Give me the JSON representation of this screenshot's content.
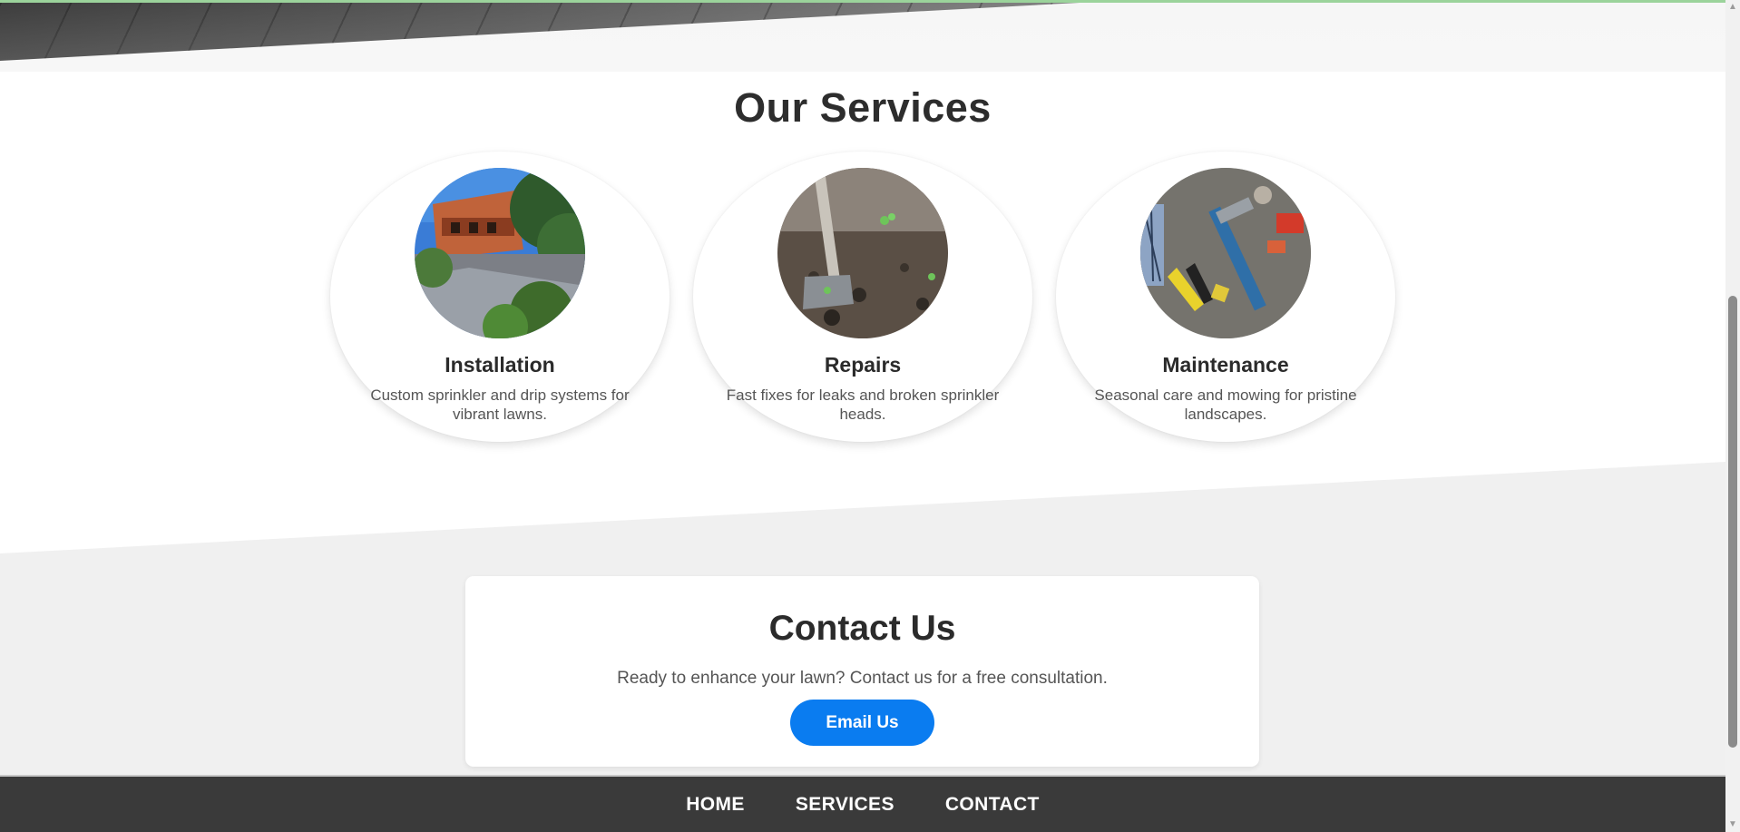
{
  "colors": {
    "accent": "#0a7cf0",
    "footer_bg": "#3a3a3a",
    "contact_bg": "#f0f0f0",
    "top_line": "#9bd39b"
  },
  "services": {
    "title": "Our Services",
    "items": [
      {
        "title": "Installation",
        "description": "Custom sprinkler and drip systems for vibrant lawns.",
        "image_icon": "building-garden-photo"
      },
      {
        "title": "Repairs",
        "description": "Fast fixes for leaks and broken sprinkler heads.",
        "image_icon": "garden-hoe-soil-photo"
      },
      {
        "title": "Maintenance",
        "description": "Seasonal care and mowing for pristine landscapes.",
        "image_icon": "tools-photo"
      }
    ]
  },
  "contact": {
    "title": "Contact Us",
    "text": "Ready to enhance your lawn? Contact us for a free consultation.",
    "button_label": "Email Us"
  },
  "footer": {
    "nav": [
      {
        "label": "HOME"
      },
      {
        "label": "SERVICES"
      },
      {
        "label": "CONTACT"
      }
    ]
  },
  "scrollbar": {
    "up_icon": "scroll-up-arrow-icon",
    "down_icon": "scroll-down-arrow-icon"
  }
}
